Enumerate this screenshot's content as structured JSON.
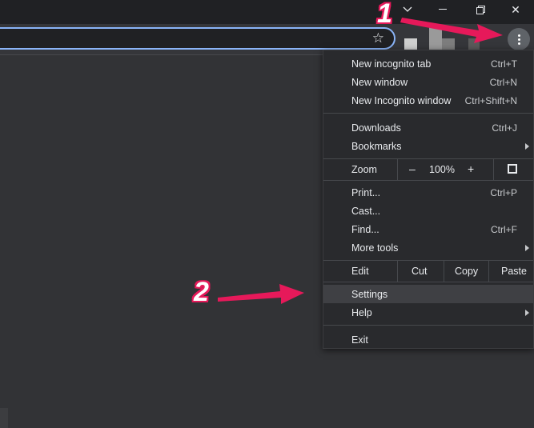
{
  "window": {
    "tab_overflow_icon": "chevron-down-icon",
    "restore_icon": "restore-icon",
    "close_label": "✕"
  },
  "annotations": {
    "step1": "1",
    "step2": "2",
    "arrow_color": "#e6195a"
  },
  "menu": {
    "items": [
      {
        "label": "New incognito tab",
        "shortcut": "Ctrl+T"
      },
      {
        "label": "New window",
        "shortcut": "Ctrl+N"
      },
      {
        "label": "New Incognito window",
        "shortcut": "Ctrl+Shift+N"
      },
      {
        "label": "Downloads",
        "shortcut": "Ctrl+J"
      },
      {
        "label": "Bookmarks",
        "shortcut": ""
      },
      {
        "label": "Print...",
        "shortcut": "Ctrl+P"
      },
      {
        "label": "Cast...",
        "shortcut": ""
      },
      {
        "label": "Find...",
        "shortcut": "Ctrl+F"
      },
      {
        "label": "More tools",
        "shortcut": ""
      },
      {
        "label": "Settings",
        "shortcut": ""
      },
      {
        "label": "Help",
        "shortcut": ""
      },
      {
        "label": "Exit",
        "shortcut": ""
      }
    ],
    "zoom": {
      "label": "Zoom",
      "minus": "–",
      "value": "100%",
      "plus": "+"
    },
    "edit": {
      "label": "Edit",
      "cut": "Cut",
      "copy": "Copy",
      "paste": "Paste"
    },
    "highlighted_item": "Settings"
  },
  "colors": {
    "accent": "#8ab4f8",
    "menu_bg": "#292a2d",
    "toolbar_bg": "#35363a"
  }
}
